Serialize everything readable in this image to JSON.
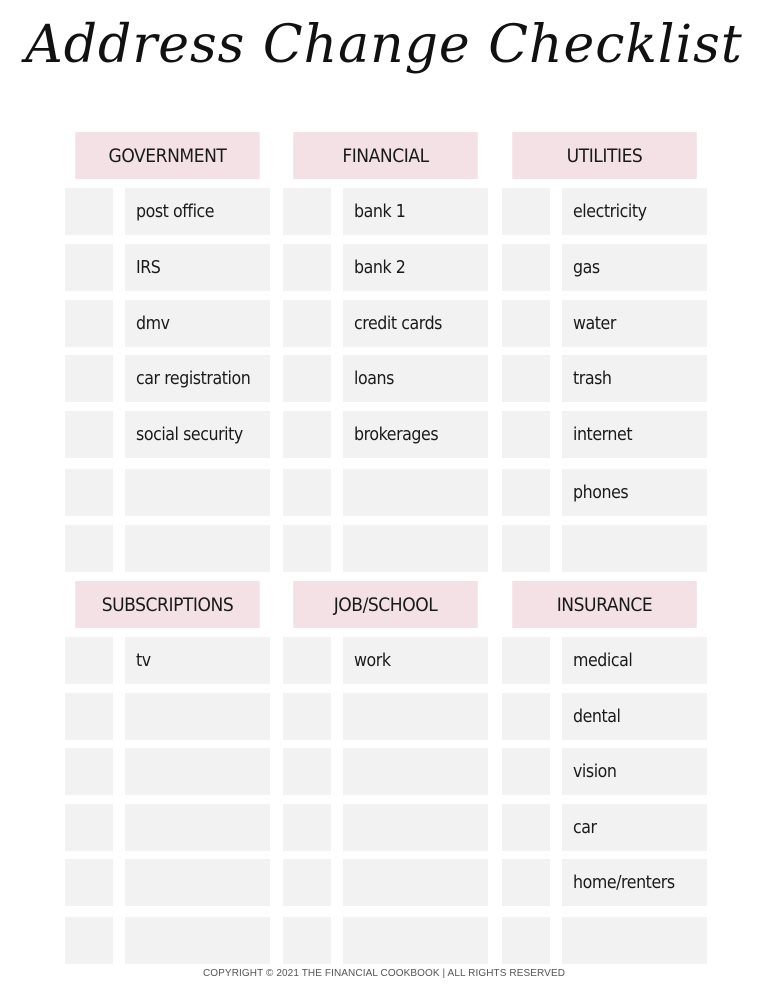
{
  "title": "Address Change Checklist",
  "sections": [
    {
      "columns": [
        {
          "header": "GOVERNMENT",
          "items": [
            "post office",
            "IRS",
            "dmv",
            "car registration",
            "social security",
            "",
            ""
          ]
        },
        {
          "header": "FINANCIAL",
          "items": [
            "bank 1",
            "bank 2",
            "credit cards",
            "loans",
            "brokerages",
            "",
            ""
          ]
        },
        {
          "header": "UTILITIES",
          "items": [
            "electricity",
            "gas",
            "water",
            "trash",
            "internet",
            "phones",
            ""
          ]
        }
      ]
    },
    {
      "columns": [
        {
          "header": "SUBSCRIPTIONS",
          "items": [
            "tv",
            "",
            "",
            "",
            "",
            ""
          ]
        },
        {
          "header": "JOB/SCHOOL",
          "items": [
            "work",
            "",
            "",
            "",
            "",
            ""
          ]
        },
        {
          "header": "INSURANCE",
          "items": [
            "medical",
            "dental",
            "vision",
            "car",
            "home/renters",
            ""
          ]
        }
      ]
    }
  ],
  "footer": "COPYRIGHT © 2021 THE FINANCIAL COOKBOOK | ALL RIGHTS RESERVED",
  "colors": {
    "header_bg": "#f3e1e5",
    "cell_bg": "#f2f2f2"
  }
}
